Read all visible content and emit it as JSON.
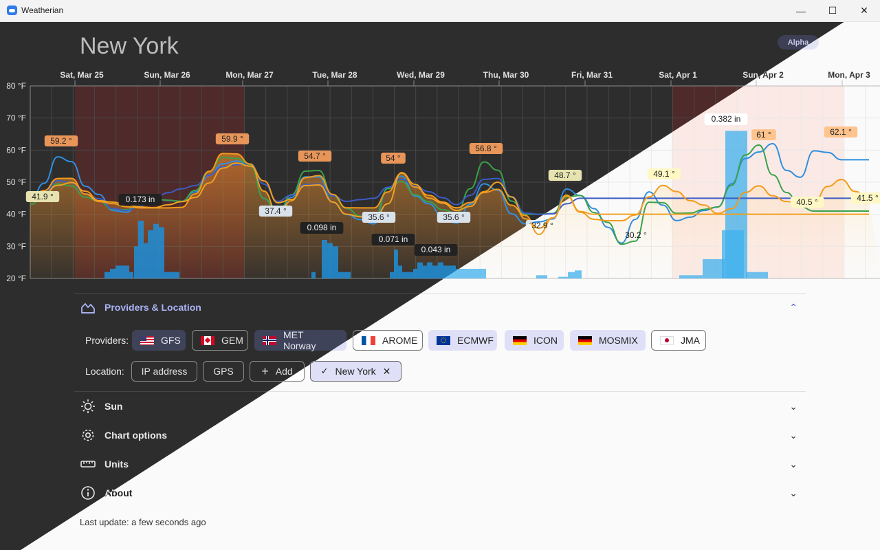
{
  "window": {
    "title": "Weatherian",
    "minimize_glyph": "—",
    "maximize_glyph": "☐",
    "close_glyph": "✕"
  },
  "page": {
    "location_title": "New York",
    "badge": "Alpha"
  },
  "chart_data": {
    "type": "line",
    "x_labels": [
      "Sat, Mar 25",
      "Sun, Mar 26",
      "Mon, Mar 27",
      "Tue, Mar 28",
      "Wed, Mar 29",
      "Thu, Mar 30",
      "Fri, Mar 31",
      "Sat, Apr 1",
      "Sun, Apr 2",
      "Mon, Apr 3"
    ],
    "y_ticks": [
      "80 °F",
      "70 °F",
      "60 °F",
      "50 °F",
      "40 °F",
      "30 °F",
      "20 °F"
    ],
    "ylim": [
      20,
      80
    ],
    "temperature_labels": [
      {
        "text": "59.2 °",
        "kind": "max"
      },
      {
        "text": "59.9 °",
        "kind": "max"
      },
      {
        "text": "54.7 °",
        "kind": "max"
      },
      {
        "text": "54 °",
        "kind": "max"
      },
      {
        "text": "56.8 °",
        "kind": "max"
      },
      {
        "text": "48.7 °",
        "kind": "mid"
      },
      {
        "text": "49.1 °",
        "kind": "mid"
      },
      {
        "text": "61 °",
        "kind": "max"
      },
      {
        "text": "62.1 °",
        "kind": "max"
      },
      {
        "text": "41.9 °",
        "kind": "mid"
      },
      {
        "text": "37.4 °",
        "kind": "min"
      },
      {
        "text": "35.6 °",
        "kind": "min"
      },
      {
        "text": "35.6 °",
        "kind": "min"
      },
      {
        "text": "32.9 °",
        "kind": "min"
      },
      {
        "text": "30.2 °",
        "kind": "min"
      },
      {
        "text": "40.5 °",
        "kind": "mid"
      },
      {
        "text": "41.5 °",
        "kind": "mid"
      }
    ],
    "precipitation_labels": [
      "0.173 in",
      "0.098 in",
      "0.071 in",
      "0.043 in",
      "0.382 in"
    ],
    "series_colors": {
      "gfs": "#2f8fe0",
      "gem": "#3aa14a",
      "met": "#3c5cc4",
      "arome": "#f39a1a",
      "ecmwf": "#f0a020"
    }
  },
  "providers_section": {
    "title": "Providers & Location",
    "providers_label": "Providers:",
    "providers": [
      {
        "label": "GFS",
        "flag": "us",
        "selected": true
      },
      {
        "label": "GEM",
        "flag": "ca",
        "selected": false
      },
      {
        "label": "MET Norway",
        "flag": "no",
        "selected": true
      },
      {
        "label": "AROME",
        "flag": "fr",
        "selected": false
      },
      {
        "label": "ECMWF",
        "flag": "eu",
        "selected": true
      },
      {
        "label": "ICON",
        "flag": "de",
        "selected": true
      },
      {
        "label": "MOSMIX",
        "flag": "de",
        "selected": true
      },
      {
        "label": "JMA",
        "flag": "jp",
        "selected": false
      }
    ],
    "location_label": "Location:",
    "location_buttons": [
      {
        "label": "IP address"
      },
      {
        "label": "GPS"
      },
      {
        "label": "Add",
        "icon": "plus-icon"
      },
      {
        "label": "New York",
        "icon": "check-icon",
        "removable": true
      }
    ]
  },
  "sections": [
    {
      "label": "Sun",
      "icon": "sun-icon"
    },
    {
      "label": "Chart options",
      "icon": "gear-icon"
    },
    {
      "label": "Units",
      "icon": "ruler-icon"
    },
    {
      "label": "About",
      "icon": "info-icon"
    }
  ],
  "footer": {
    "text": "Last update: a few seconds ago"
  }
}
